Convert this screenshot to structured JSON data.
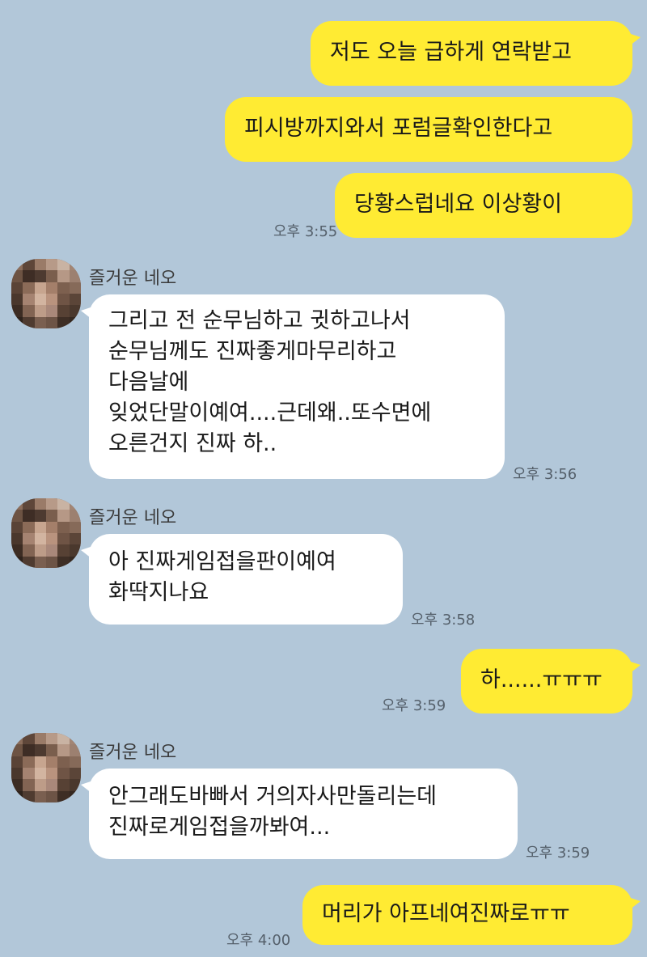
{
  "colors": {
    "background": "#b2c7d9",
    "my_bubble": "#ffeb33",
    "their_bubble": "#ffffff"
  },
  "messages": {
    "m1": "저도 오늘 급하게 연락받고",
    "m2": "피시방까지와서 포럼글확인한다고",
    "m3": "당황스럽네요 이상황이",
    "m3_time": "오후 3:55",
    "g1_sender": "즐거운 네오",
    "m4": "그리고 전 순무님하고 귓하고나서\n순무님께도 진짜좋게마무리하고\n다음날에\n잊었단말이예여....근데왜..또수면에\n오른건지 진짜 하..",
    "m4_time": "오후 3:56",
    "g2_sender": "즐거운 네오",
    "m5": "아 진짜게임접을판이예여\n화딱지나요",
    "m5_time": "오후 3:58",
    "m6": "하......ㅠㅠㅠ",
    "m6_time": "오후 3:59",
    "g3_sender": "즐거운 네오",
    "m7": "안그래도바빠서 거의자사만돌리는데\n진짜로게임접을까봐여...",
    "m7_time": "오후 3:59",
    "m8": "머리가 아프네여진짜로ㅠㅠ",
    "m8_time": "오후 4:00"
  },
  "avatar": {
    "icon": "blurred-profile-avatar"
  }
}
